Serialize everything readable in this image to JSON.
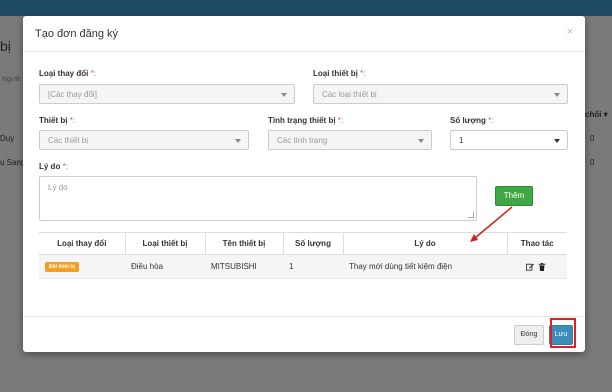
{
  "background": {
    "title": "bị",
    "subtitle": "Ngườ",
    "row1_name": "Duy",
    "row2_name": "u Sang",
    "right_header": "chối ▾",
    "right_val1": "0",
    "right_val2": "0"
  },
  "modal": {
    "title": "Tạo đơn đăng ký",
    "close_symbol": "×"
  },
  "form": {
    "change_type": {
      "label": "Loại thay đổi",
      "value": "[Các thay đổi]"
    },
    "device_type": {
      "label": "Loại thiết bị",
      "value": "Các loại thiết bị"
    },
    "device": {
      "label": "Thiết bị",
      "value": "Các thiết bị"
    },
    "device_status": {
      "label": "Tình trạng thiết bị",
      "value": "Các tình trạng"
    },
    "quantity": {
      "label": "Số lượng",
      "value": "1"
    },
    "reason": {
      "label": "Lý do",
      "placeholder": "Lý do"
    },
    "required_mark": "*:",
    "add_button": "Thêm"
  },
  "table": {
    "headers": [
      "Loại thay đổi",
      "Loại thiết bị",
      "Tên thiết bị",
      "Số lượng",
      "Lý do",
      "Thao tác"
    ],
    "rows": [
      {
        "change_type": "Đổi thiết bị",
        "device_type": "Điều hòa",
        "device_name": "MITSUBISHI",
        "quantity": "1",
        "reason": "Thay mới dùng tiết kiệm điện"
      }
    ]
  },
  "footer": {
    "close_button": "Đóng",
    "save_button": "Lưu"
  },
  "colors": {
    "accent_green": "#3fa844",
    "accent_blue": "#3c8dbc",
    "badge_orange": "#f0a020",
    "highlight_red": "#e02020"
  },
  "icons": [
    "edit-icon",
    "trash-icon",
    "close-icon"
  ]
}
